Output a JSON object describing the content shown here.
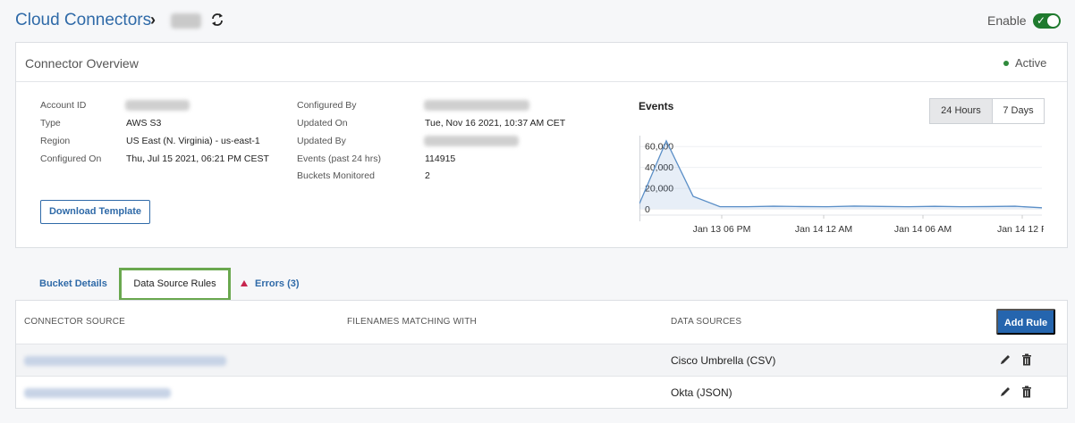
{
  "header": {
    "title": "Cloud Connectors",
    "separator": "›",
    "enable_label": "Enable",
    "enabled": true
  },
  "overview": {
    "title": "Connector Overview",
    "status": "Active",
    "status_color": "#2f8a3b",
    "left": [
      {
        "label": "Account ID",
        "value": ""
      },
      {
        "label": "Type",
        "value": "AWS S3"
      },
      {
        "label": "Region",
        "value": "US East (N. Virginia) - us-east-1"
      },
      {
        "label": "Configured On",
        "value": "Thu, Jul 15 2021, 06:21 PM CEST"
      }
    ],
    "right": [
      {
        "label": "Configured By",
        "value": ""
      },
      {
        "label": "Updated On",
        "value": "Tue, Nov 16 2021, 10:37 AM CET"
      },
      {
        "label": "Updated By",
        "value": ""
      },
      {
        "label": "Events (past 24 hrs)",
        "value": "114915"
      },
      {
        "label": "Buckets Monitored",
        "value": "2"
      }
    ],
    "download_label": "Download Template"
  },
  "events": {
    "title": "Events",
    "range_options": [
      "24 Hours",
      "7 Days"
    ],
    "selected_range": "24 Hours"
  },
  "chart_data": {
    "type": "area",
    "title": "Events",
    "xlabel": "",
    "ylabel": "",
    "ylim": [
      0,
      70000
    ],
    "y_ticks": [
      "0",
      "20,000",
      "40,000",
      "60,000"
    ],
    "x_ticks": [
      "Jan 13 06 PM",
      "Jan 14 12 AM",
      "Jan 14 06 AM",
      "Jan 14 12 P"
    ],
    "series": [
      {
        "values": [
          5000,
          65000,
          12000,
          2000,
          2000,
          2500,
          2200,
          2000,
          2600,
          2300,
          2000,
          2400,
          2000,
          2200,
          2500,
          1000
        ]
      }
    ],
    "color": "#5b8fc7",
    "grid": true
  },
  "tabs": [
    {
      "label": "Bucket Details"
    },
    {
      "label": "Data Source Rules"
    },
    {
      "label": "Errors (3)"
    }
  ],
  "active_tab": "Data Source Rules",
  "table": {
    "columns": [
      "CONNECTOR SOURCE",
      "FILENAMES MATCHING WITH",
      "DATA SOURCES"
    ],
    "add_label": "Add Rule",
    "rows": [
      {
        "source": "",
        "matching": "",
        "data_source": "Cisco Umbrella (CSV)"
      },
      {
        "source": "",
        "matching": "",
        "data_source": "Okta (JSON)"
      }
    ]
  },
  "icons": [
    "refresh-icon",
    "check-icon",
    "alert-triangle-icon",
    "edit-icon",
    "trash-icon"
  ]
}
